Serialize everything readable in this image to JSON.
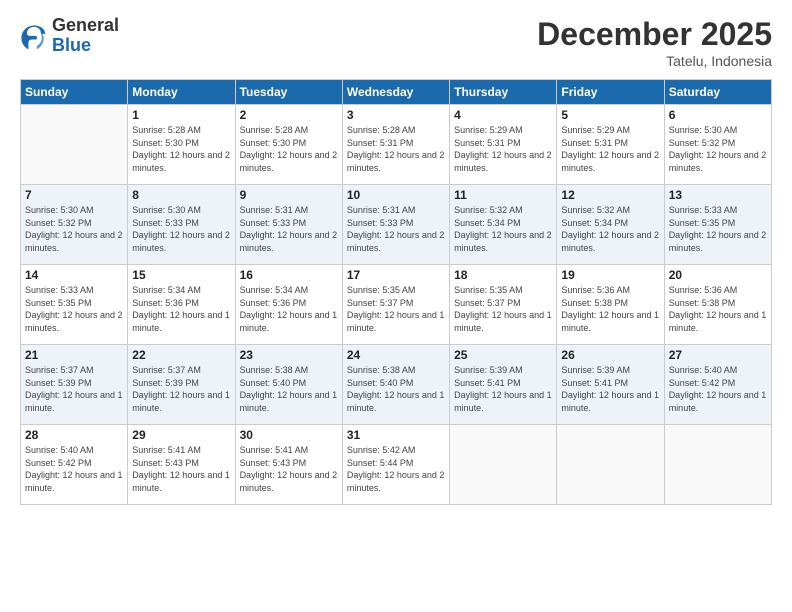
{
  "logo": {
    "general": "General",
    "blue": "Blue"
  },
  "title": "December 2025",
  "subtitle": "Tatelu, Indonesia",
  "days_of_week": [
    "Sunday",
    "Monday",
    "Tuesday",
    "Wednesday",
    "Thursday",
    "Friday",
    "Saturday"
  ],
  "weeks": [
    [
      {
        "day": "",
        "sunrise": "",
        "sunset": "",
        "daylight": ""
      },
      {
        "day": "1",
        "sunrise": "Sunrise: 5:28 AM",
        "sunset": "Sunset: 5:30 PM",
        "daylight": "Daylight: 12 hours and 2 minutes."
      },
      {
        "day": "2",
        "sunrise": "Sunrise: 5:28 AM",
        "sunset": "Sunset: 5:30 PM",
        "daylight": "Daylight: 12 hours and 2 minutes."
      },
      {
        "day": "3",
        "sunrise": "Sunrise: 5:28 AM",
        "sunset": "Sunset: 5:31 PM",
        "daylight": "Daylight: 12 hours and 2 minutes."
      },
      {
        "day": "4",
        "sunrise": "Sunrise: 5:29 AM",
        "sunset": "Sunset: 5:31 PM",
        "daylight": "Daylight: 12 hours and 2 minutes."
      },
      {
        "day": "5",
        "sunrise": "Sunrise: 5:29 AM",
        "sunset": "Sunset: 5:31 PM",
        "daylight": "Daylight: 12 hours and 2 minutes."
      },
      {
        "day": "6",
        "sunrise": "Sunrise: 5:30 AM",
        "sunset": "Sunset: 5:32 PM",
        "daylight": "Daylight: 12 hours and 2 minutes."
      }
    ],
    [
      {
        "day": "7",
        "sunrise": "Sunrise: 5:30 AM",
        "sunset": "Sunset: 5:32 PM",
        "daylight": "Daylight: 12 hours and 2 minutes."
      },
      {
        "day": "8",
        "sunrise": "Sunrise: 5:30 AM",
        "sunset": "Sunset: 5:33 PM",
        "daylight": "Daylight: 12 hours and 2 minutes."
      },
      {
        "day": "9",
        "sunrise": "Sunrise: 5:31 AM",
        "sunset": "Sunset: 5:33 PM",
        "daylight": "Daylight: 12 hours and 2 minutes."
      },
      {
        "day": "10",
        "sunrise": "Sunrise: 5:31 AM",
        "sunset": "Sunset: 5:33 PM",
        "daylight": "Daylight: 12 hours and 2 minutes."
      },
      {
        "day": "11",
        "sunrise": "Sunrise: 5:32 AM",
        "sunset": "Sunset: 5:34 PM",
        "daylight": "Daylight: 12 hours and 2 minutes."
      },
      {
        "day": "12",
        "sunrise": "Sunrise: 5:32 AM",
        "sunset": "Sunset: 5:34 PM",
        "daylight": "Daylight: 12 hours and 2 minutes."
      },
      {
        "day": "13",
        "sunrise": "Sunrise: 5:33 AM",
        "sunset": "Sunset: 5:35 PM",
        "daylight": "Daylight: 12 hours and 2 minutes."
      }
    ],
    [
      {
        "day": "14",
        "sunrise": "Sunrise: 5:33 AM",
        "sunset": "Sunset: 5:35 PM",
        "daylight": "Daylight: 12 hours and 2 minutes."
      },
      {
        "day": "15",
        "sunrise": "Sunrise: 5:34 AM",
        "sunset": "Sunset: 5:36 PM",
        "daylight": "Daylight: 12 hours and 1 minute."
      },
      {
        "day": "16",
        "sunrise": "Sunrise: 5:34 AM",
        "sunset": "Sunset: 5:36 PM",
        "daylight": "Daylight: 12 hours and 1 minute."
      },
      {
        "day": "17",
        "sunrise": "Sunrise: 5:35 AM",
        "sunset": "Sunset: 5:37 PM",
        "daylight": "Daylight: 12 hours and 1 minute."
      },
      {
        "day": "18",
        "sunrise": "Sunrise: 5:35 AM",
        "sunset": "Sunset: 5:37 PM",
        "daylight": "Daylight: 12 hours and 1 minute."
      },
      {
        "day": "19",
        "sunrise": "Sunrise: 5:36 AM",
        "sunset": "Sunset: 5:38 PM",
        "daylight": "Daylight: 12 hours and 1 minute."
      },
      {
        "day": "20",
        "sunrise": "Sunrise: 5:36 AM",
        "sunset": "Sunset: 5:38 PM",
        "daylight": "Daylight: 12 hours and 1 minute."
      }
    ],
    [
      {
        "day": "21",
        "sunrise": "Sunrise: 5:37 AM",
        "sunset": "Sunset: 5:39 PM",
        "daylight": "Daylight: 12 hours and 1 minute."
      },
      {
        "day": "22",
        "sunrise": "Sunrise: 5:37 AM",
        "sunset": "Sunset: 5:39 PM",
        "daylight": "Daylight: 12 hours and 1 minute."
      },
      {
        "day": "23",
        "sunrise": "Sunrise: 5:38 AM",
        "sunset": "Sunset: 5:40 PM",
        "daylight": "Daylight: 12 hours and 1 minute."
      },
      {
        "day": "24",
        "sunrise": "Sunrise: 5:38 AM",
        "sunset": "Sunset: 5:40 PM",
        "daylight": "Daylight: 12 hours and 1 minute."
      },
      {
        "day": "25",
        "sunrise": "Sunrise: 5:39 AM",
        "sunset": "Sunset: 5:41 PM",
        "daylight": "Daylight: 12 hours and 1 minute."
      },
      {
        "day": "26",
        "sunrise": "Sunrise: 5:39 AM",
        "sunset": "Sunset: 5:41 PM",
        "daylight": "Daylight: 12 hours and 1 minute."
      },
      {
        "day": "27",
        "sunrise": "Sunrise: 5:40 AM",
        "sunset": "Sunset: 5:42 PM",
        "daylight": "Daylight: 12 hours and 1 minute."
      }
    ],
    [
      {
        "day": "28",
        "sunrise": "Sunrise: 5:40 AM",
        "sunset": "Sunset: 5:42 PM",
        "daylight": "Daylight: 12 hours and 1 minute."
      },
      {
        "day": "29",
        "sunrise": "Sunrise: 5:41 AM",
        "sunset": "Sunset: 5:43 PM",
        "daylight": "Daylight: 12 hours and 1 minute."
      },
      {
        "day": "30",
        "sunrise": "Sunrise: 5:41 AM",
        "sunset": "Sunset: 5:43 PM",
        "daylight": "Daylight: 12 hours and 2 minutes."
      },
      {
        "day": "31",
        "sunrise": "Sunrise: 5:42 AM",
        "sunset": "Sunset: 5:44 PM",
        "daylight": "Daylight: 12 hours and 2 minutes."
      },
      {
        "day": "",
        "sunrise": "",
        "sunset": "",
        "daylight": ""
      },
      {
        "day": "",
        "sunrise": "",
        "sunset": "",
        "daylight": ""
      },
      {
        "day": "",
        "sunrise": "",
        "sunset": "",
        "daylight": ""
      }
    ]
  ]
}
